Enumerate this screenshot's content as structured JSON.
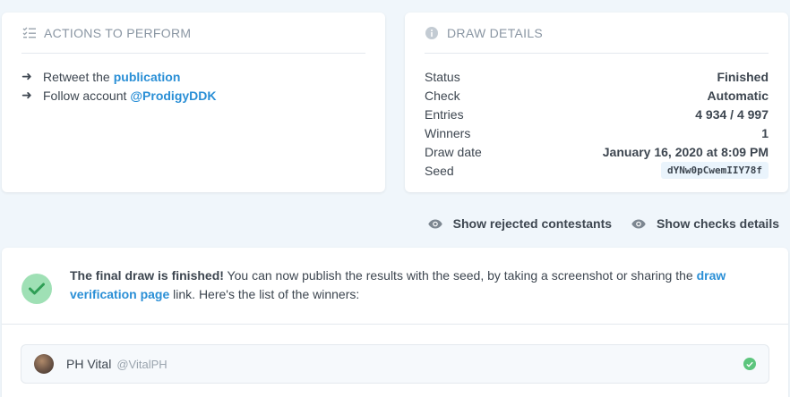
{
  "actions": {
    "title": "ACTIONS TO PERFORM",
    "items": [
      {
        "text": "Retweet the",
        "link": "publication"
      },
      {
        "text": "Follow account",
        "link": "@ProdigyDDK"
      }
    ]
  },
  "details": {
    "title": "DRAW DETAILS",
    "rows": [
      {
        "key": "Status",
        "value": "Finished"
      },
      {
        "key": "Check",
        "value": "Automatic"
      },
      {
        "key": "Entries",
        "value": "4 934 / 4 997"
      },
      {
        "key": "Winners",
        "value": "1"
      },
      {
        "key": "Draw date",
        "value": "January 16, 2020 at 8:09 PM"
      },
      {
        "key": "Seed",
        "value": "dYNw0pCwemIIY78f"
      }
    ]
  },
  "toolbar": {
    "rejected_label": "Show rejected contestants",
    "checks_label": "Show checks details"
  },
  "result": {
    "bold": "The final draw is finished!",
    "text1": " You can now publish the results with the seed, by taking a screenshot or sharing the ",
    "link": "draw verification page",
    "text2": " link. Here's the list of the winners:"
  },
  "winners": [
    {
      "name": "PH Vital",
      "handle": "@VitalPH"
    }
  ],
  "colors": {
    "accent": "#2a8fd6",
    "success": "#5cc57d",
    "success_light": "#9fe0b5",
    "background": "#f0f6fb"
  }
}
